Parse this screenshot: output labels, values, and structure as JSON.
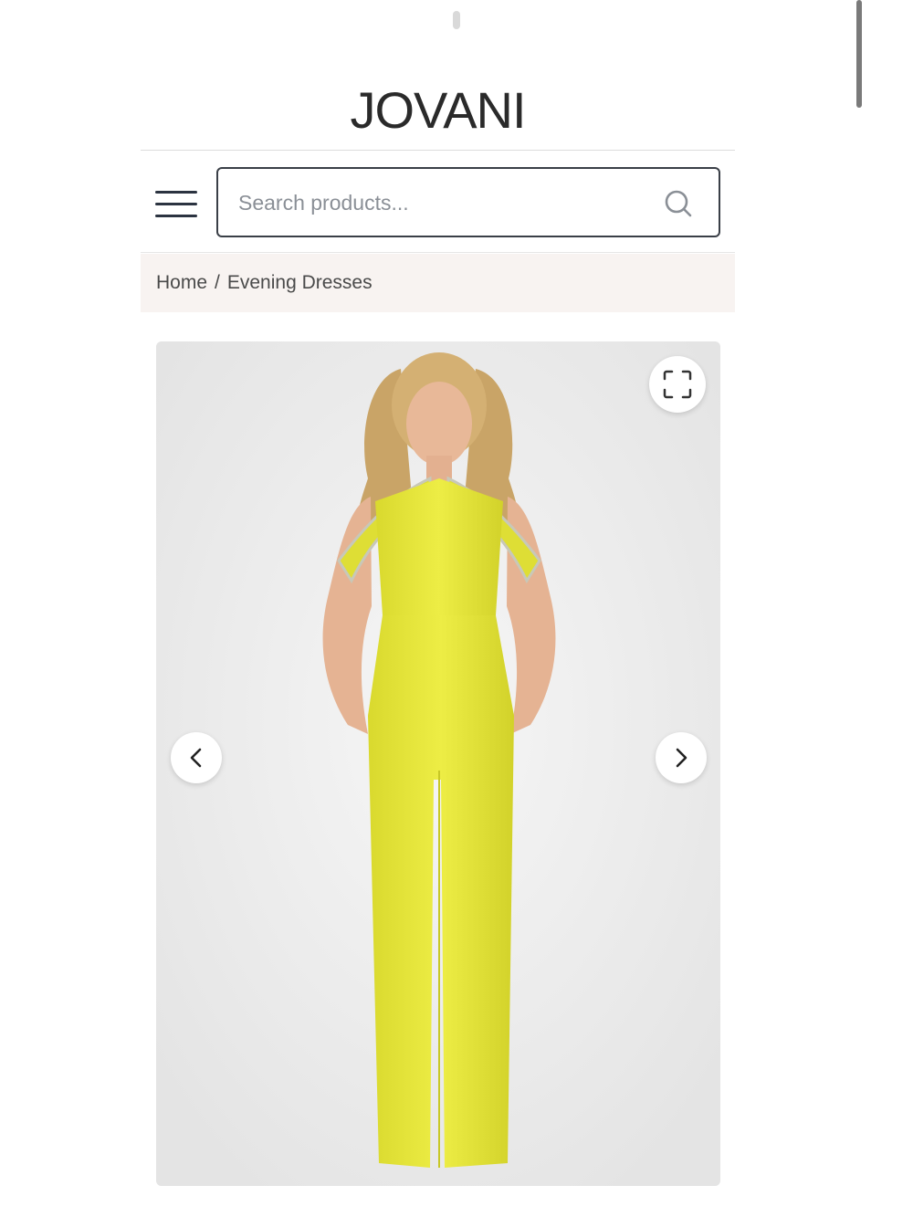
{
  "brand": {
    "logo": "JOVANI"
  },
  "header": {
    "menu_icon": "hamburger-menu-icon",
    "search": {
      "placeholder": "Search products...",
      "value": "",
      "icon": "search-icon"
    }
  },
  "breadcrumb": {
    "items": [
      "Home",
      "Evening Dresses"
    ],
    "separator": "/"
  },
  "gallery": {
    "image_description_icon": "product-photo",
    "fullscreen_icon": "fullscreen-icon",
    "prev_icon": "chevron-left-icon",
    "next_icon": "chevron-right-icon",
    "garment_color": "#e6e63a"
  },
  "colors": {
    "breadcrumb_bg": "#f8f3f1",
    "text": "#3a3a3a",
    "border": "#3a3f47"
  }
}
